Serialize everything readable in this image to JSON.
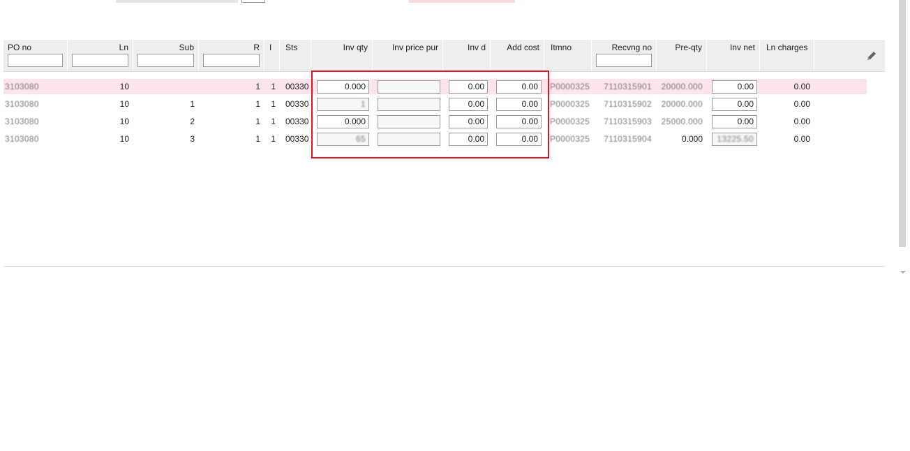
{
  "columns": {
    "po_no": "PO no",
    "ln": "Ln",
    "sub": "Sub",
    "r": "R",
    "i": "I",
    "sts": "Sts",
    "inv_qty": "Inv qty",
    "inv_price_pur": "Inv price pur",
    "inv_d": "Inv d",
    "add_cost": "Add cost",
    "itmno": "Itmno",
    "recvng_no": "Recvng no",
    "pre_qty": "Pre-qty",
    "inv_net": "Inv net",
    "ln_charges": "Ln charges"
  },
  "rows": [
    {
      "po_no": "3103080",
      "ln": "10",
      "sub": "",
      "r": "1",
      "i": "1",
      "sts": "00330",
      "inv_qty": "0.000",
      "inv_price_pur": "",
      "inv_d": "0.00",
      "add_cost": "0.00",
      "itmno": "P0000325",
      "recvng_no": "7110315901",
      "pre_qty": "20000.000",
      "inv_net": "0.00",
      "ln_charges": "0.00"
    },
    {
      "po_no": "3103080",
      "ln": "10",
      "sub": "1",
      "r": "1",
      "i": "1",
      "sts": "00330",
      "inv_qty": "1",
      "inv_price_pur": "",
      "inv_d": "0.00",
      "add_cost": "0.00",
      "itmno": "P0000325",
      "recvng_no": "7110315902",
      "pre_qty": "20000.000",
      "inv_net": "0.00",
      "ln_charges": "0.00"
    },
    {
      "po_no": "3103080",
      "ln": "10",
      "sub": "2",
      "r": "1",
      "i": "1",
      "sts": "00330",
      "inv_qty": "0.000",
      "inv_price_pur": "",
      "inv_d": "0.00",
      "add_cost": "0.00",
      "itmno": "P0000325",
      "recvng_no": "7110315903",
      "pre_qty": "25000.000",
      "inv_net": "0.00",
      "ln_charges": "0.00"
    },
    {
      "po_no": "3103080",
      "ln": "10",
      "sub": "3",
      "r": "1",
      "i": "1",
      "sts": "00330",
      "inv_qty": "65",
      "inv_price_pur": "",
      "inv_d": "0.00",
      "add_cost": "0.00",
      "itmno": "P0000325",
      "recvng_no": "7110315904",
      "pre_qty": "0.000",
      "inv_net": "13225.50",
      "ln_charges": "0.00"
    }
  ],
  "colors": {
    "selected_row": "#fce4ea",
    "highlight_border": "#e0141e",
    "header_bg": "#eeeeee"
  },
  "icons": {
    "edit": "pencil-icon"
  }
}
